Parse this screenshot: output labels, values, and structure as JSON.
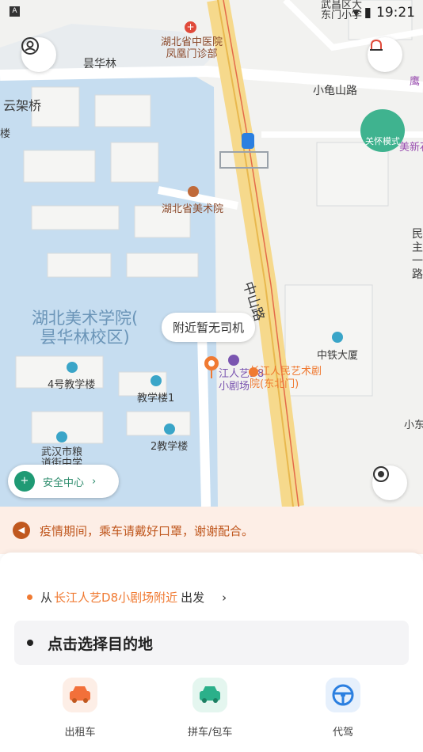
{
  "status_bar": {
    "time": "19:21",
    "left_badge": "A"
  },
  "map": {
    "labels": {
      "hospital": "湖北省中医院\n凤凰门诊部",
      "minhualin": "昙华林",
      "yunjiaqiao": "云架桥",
      "xiaoguishan": "小龟山路",
      "artmuseum": "湖北省美术院",
      "academy": "湖北美术学院(\n昙华林校区)",
      "zhongshan": "中山路",
      "crec": "中铁大厦",
      "building4": "4号教学楼",
      "building1": "教学楼1",
      "building2": "2教学楼",
      "grain": "武汉市粮\n道街中学",
      "theater_a": "江人艺D8\n小剧场",
      "theater_b": "长江人民艺术剧\n院(东北门)",
      "minzhu": "民\n主\n一\n路",
      "top_right": "武昌区大\n东门小学",
      "xiaodong": "小东",
      "ying": "鹰",
      "meixin": "美新石",
      "lou": "楼",
      "care_mode": "关怀模式"
    },
    "tooltip": "附近暂无司机",
    "safety_label": "安全中心"
  },
  "notice": {
    "text": "疫情期间，乘车请戴好口罩，谢谢配合。"
  },
  "trip": {
    "from_prefix": "从",
    "from_place": "长江人艺D8小剧场附近",
    "from_suffix": "出发",
    "destination_placeholder": "点击选择目的地"
  },
  "services": [
    {
      "label": "出租车",
      "color": "#f2703a",
      "bg": "#fdeee6"
    },
    {
      "label": "拼车/包车",
      "color": "#2bb08a",
      "bg": "#e4f6ef"
    },
    {
      "label": "代驾",
      "color": "#2b7fe0",
      "bg": "#e6f0fc"
    }
  ]
}
